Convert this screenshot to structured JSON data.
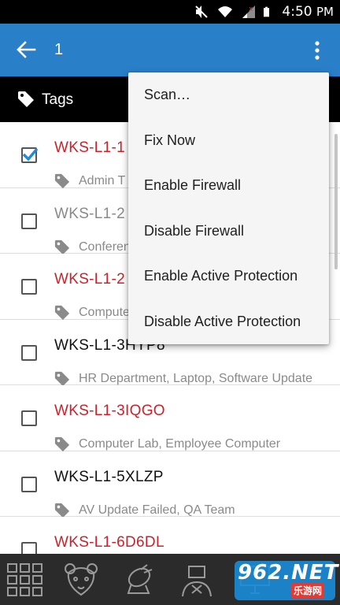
{
  "statusbar": {
    "time": "4:50",
    "meridiem": "PM",
    "icons": [
      "mute-icon",
      "wifi-icon",
      "signal-icon",
      "battery-icon"
    ]
  },
  "appbar": {
    "title": "1",
    "color": "#2a7fc9"
  },
  "tagsbar": {
    "label": "Tags"
  },
  "list": {
    "rows": [
      {
        "name": "WKS-L1-1",
        "name_color": "red",
        "tags": "Admin T",
        "checked": true
      },
      {
        "name": "WKS-L1-2",
        "name_color": "grey",
        "tags": "Conferen",
        "checked": false
      },
      {
        "name": "WKS-L1-2",
        "name_color": "red",
        "tags": "Compute",
        "checked": false
      },
      {
        "name": "WKS-L1-3HYP8",
        "name_color": "black",
        "tags": "HR Department, Laptop, Software Update",
        "checked": false
      },
      {
        "name": "WKS-L1-3IQGO",
        "name_color": "red",
        "tags": "Computer Lab, Employee Computer",
        "checked": false
      },
      {
        "name": "WKS-L1-5XLZP",
        "name_color": "black",
        "tags": "AV Update Failed, QA Team",
        "checked": false
      },
      {
        "name": "WKS-L1-6D6DL",
        "name_color": "red",
        "tags": "",
        "checked": false
      }
    ]
  },
  "menu": {
    "items": [
      "Scan…",
      "Fix Now",
      "Enable Firewall",
      "Disable Firewall",
      "Enable Active Protection",
      "Disable Active Protection"
    ]
  },
  "bottomnav": {
    "items": [
      "grid-icon",
      "bear-icon",
      "satellite-icon",
      "agent-icon",
      "computer-icon"
    ]
  },
  "watermark": {
    "brand": "962.NET",
    "sub": "乐游网"
  },
  "colors": {
    "accent": "#2a7fc9",
    "alert_red": "#c8232c",
    "checkbox_blue": "#1f8ad6"
  }
}
